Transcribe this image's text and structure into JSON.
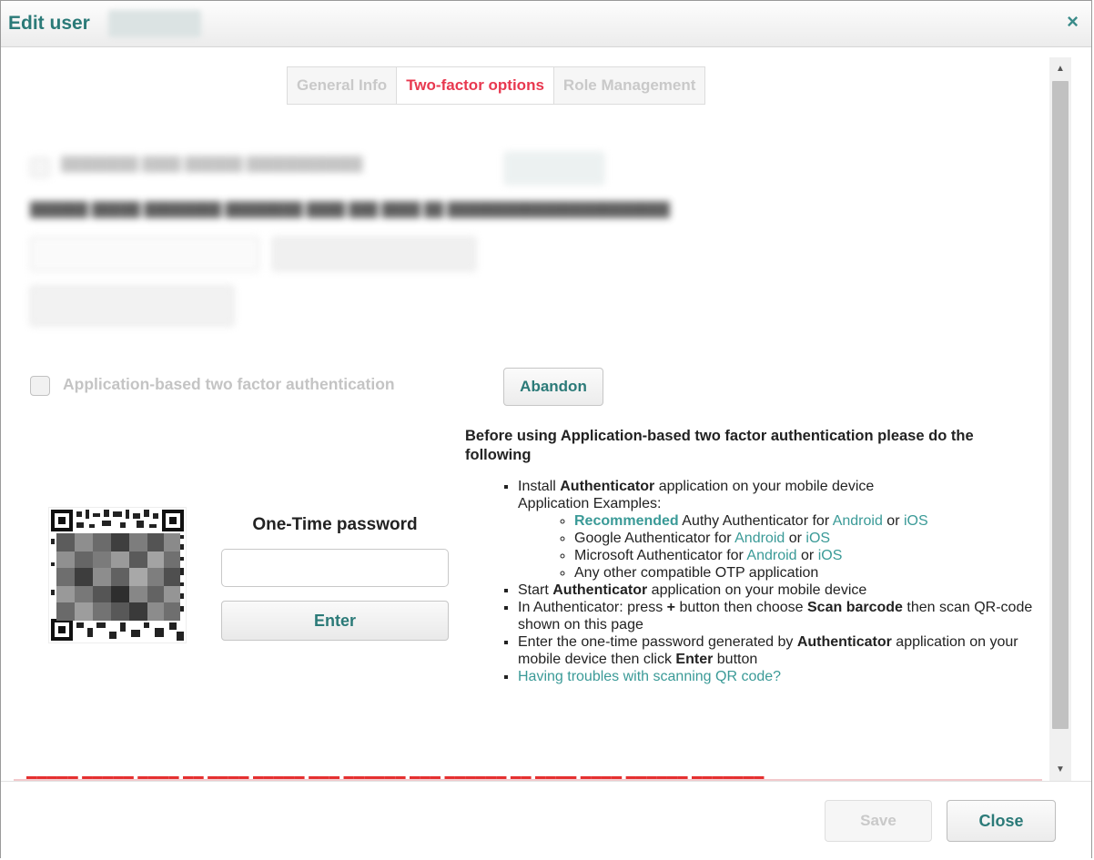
{
  "dialog": {
    "title": "Edit user",
    "close_icon": "×"
  },
  "tabs": [
    {
      "label": "General Info",
      "active": false
    },
    {
      "label": "Two-factor options",
      "active": true
    },
    {
      "label": "Role Management",
      "active": false
    }
  ],
  "app_auth": {
    "checkbox_label": "Application-based two factor authentication",
    "checked": false,
    "abandon_label": "Abandon"
  },
  "otp": {
    "label": "One-Time password",
    "value": "",
    "enter_label": "Enter"
  },
  "instructions": {
    "heading": "Before using Application-based two factor authentication please do the following",
    "step1_prefix": "Install ",
    "step1_bold": "Authenticator",
    "step1_suffix": " application on your mobile device",
    "examples_label": "Application Examples:",
    "ex1_recommended": "Recommended",
    "ex1_text": " Authy Authenticator for ",
    "ex2_text": "Google Authenticator for ",
    "ex3_text": "Microsoft Authenticator for ",
    "ex4_text": "Any other compatible OTP application",
    "android": "Android",
    "or": " or ",
    "ios": "iOS",
    "step2_prefix": "Start ",
    "step2_bold": "Authenticator",
    "step2_suffix": " application on your mobile device",
    "step3_prefix": "In Authenticator: press ",
    "step3_plus": "+",
    "step3_mid": " button then choose ",
    "step3_bold": "Scan barcode",
    "step3_suffix": " then scan QR-code shown on this page",
    "step4_prefix": "Enter the one-time password generated by ",
    "step4_bold": "Authenticator",
    "step4_mid": " application on your mobile device then click ",
    "step4_bold2": "Enter",
    "step4_suffix": " button",
    "troubles_link": "Having troubles with scanning QR code?"
  },
  "footer": {
    "save_label": "Save",
    "close_label": "Close"
  },
  "colors": {
    "accent": "#2b7a78",
    "link": "#3a9a97",
    "active_tab": "#e8384f",
    "warning": "#e53030"
  }
}
